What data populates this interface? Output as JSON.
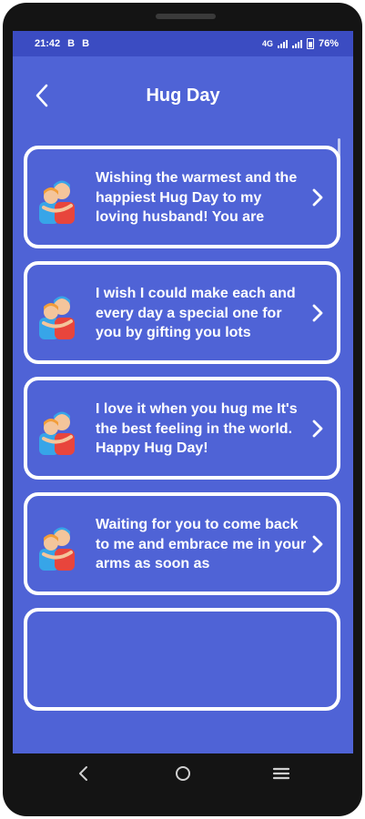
{
  "status_bar": {
    "time": "21:42",
    "left_icons": [
      "B",
      "B"
    ],
    "network": "4G",
    "battery": "76%"
  },
  "header": {
    "title": "Hug Day"
  },
  "messages": [
    {
      "text": "Wishing the warmest and the happiest Hug Day to my loving husband! You are"
    },
    {
      "text": "I wish I could make each and every day a special one for you by gifting you lots"
    },
    {
      "text": "I love it when you hug me It's the best feeling in the world. Happy Hug Day!"
    },
    {
      "text": "Waiting for you to come back to me and embrace me in your arms as soon as"
    }
  ],
  "colors": {
    "screen_bg": "#4f63d6",
    "status_bar_bg": "#3b4cc2",
    "card_border": "#ffffff",
    "text": "#ffffff"
  },
  "icons": {
    "back": "chevron-left-icon",
    "card_icon": "hugging-couple-icon",
    "card_arrow": "chevron-right-icon",
    "nav_back": "triangle-back-icon",
    "nav_home": "circle-home-icon",
    "nav_recents": "menu-lines-icon"
  }
}
